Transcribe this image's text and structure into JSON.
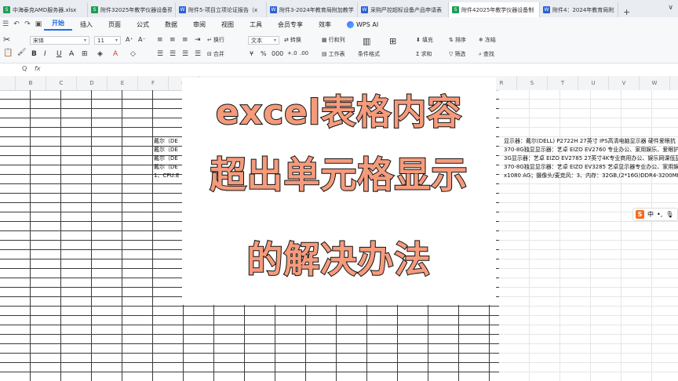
{
  "tabs": [
    {
      "label": "中海泰克AMD服务器.xlsx",
      "type": "x",
      "active": false
    },
    {
      "label": "附件32025年教学仪器设备预算",
      "type": "x",
      "active": false
    },
    {
      "label": "附件5-项目立项论证报告（x",
      "type": "w",
      "active": false
    },
    {
      "label": "附件3-2024年教育局附加教学仪",
      "type": "w",
      "active": false
    },
    {
      "label": "采购严控超标设备产品申请表（",
      "type": "w",
      "active": false
    },
    {
      "label": "附件42025年教学仪器设备制",
      "type": "x",
      "active": true
    },
    {
      "label": "附件4：2024年教育局附加...",
      "type": "w",
      "active": false
    }
  ],
  "new_tab": "+",
  "window_controls": "∨",
  "menu": {
    "items": [
      "开始",
      "插入",
      "页面",
      "公式",
      "数据",
      "审阅",
      "视图",
      "工具",
      "会员专享",
      "效率"
    ],
    "active": "开始",
    "ai": "WPS AI"
  },
  "ribbon": {
    "font_name": "宋体",
    "font_size": "11",
    "wrap": "换行",
    "merge": "合并",
    "number_format": "文本",
    "convert": "转换",
    "rows_cols": "行和列",
    "worksheet": "工作表",
    "cond_format": "条件格式",
    "fill": "填充",
    "sort": "排序",
    "freeze": "冻结",
    "sum": "求和",
    "filter": "筛选",
    "find": "查找",
    "paste_icon": "粘贴"
  },
  "formula_bar": {
    "fx": "fx",
    "zoom": "Q"
  },
  "columns_left": [
    "B",
    "C",
    "D",
    "E",
    "F",
    "G"
  ],
  "columns_right": [
    "R",
    "S",
    "T",
    "U",
    "V",
    "W"
  ],
  "cells_left": [
    "戴尔（DE",
    "戴尔（DE",
    "戴尔（DE",
    "戴尔（DE",
    "1、CPU:E"
  ],
  "cells_right": [
    "显示器：戴尔(DELL) P2722H 27英寸 IPS高清电脑显示器 硬件爱眼抗",
    "370-8G独显显示器：艺卓 EIZO EV2760 专业办公、家用娱乐、爱眼护",
    "3G显示器：艺卓 EIZO EV2785 27英寸4K专业商用办公、娱乐网课低蓝",
    "370-8G独显显示器：艺卓 EIZO EV3285 艺卓显示器专业办公、家用娱",
    "x1080 AG；摄像头/麦克风：3、内存：32GB,(2*16G)DDR4-3200MHz 扌"
  ],
  "overlay": {
    "line1": "excel表格内容",
    "line2": "超出单元格显示",
    "line3": "的解决办法"
  },
  "ime": {
    "logo": "S",
    "mode": "中",
    "punct": "•,",
    "mic": "🎙"
  },
  "colors": {
    "accent": "#1f6fe5",
    "title_fill": "#f49b7c",
    "title_stroke": "#111111"
  }
}
